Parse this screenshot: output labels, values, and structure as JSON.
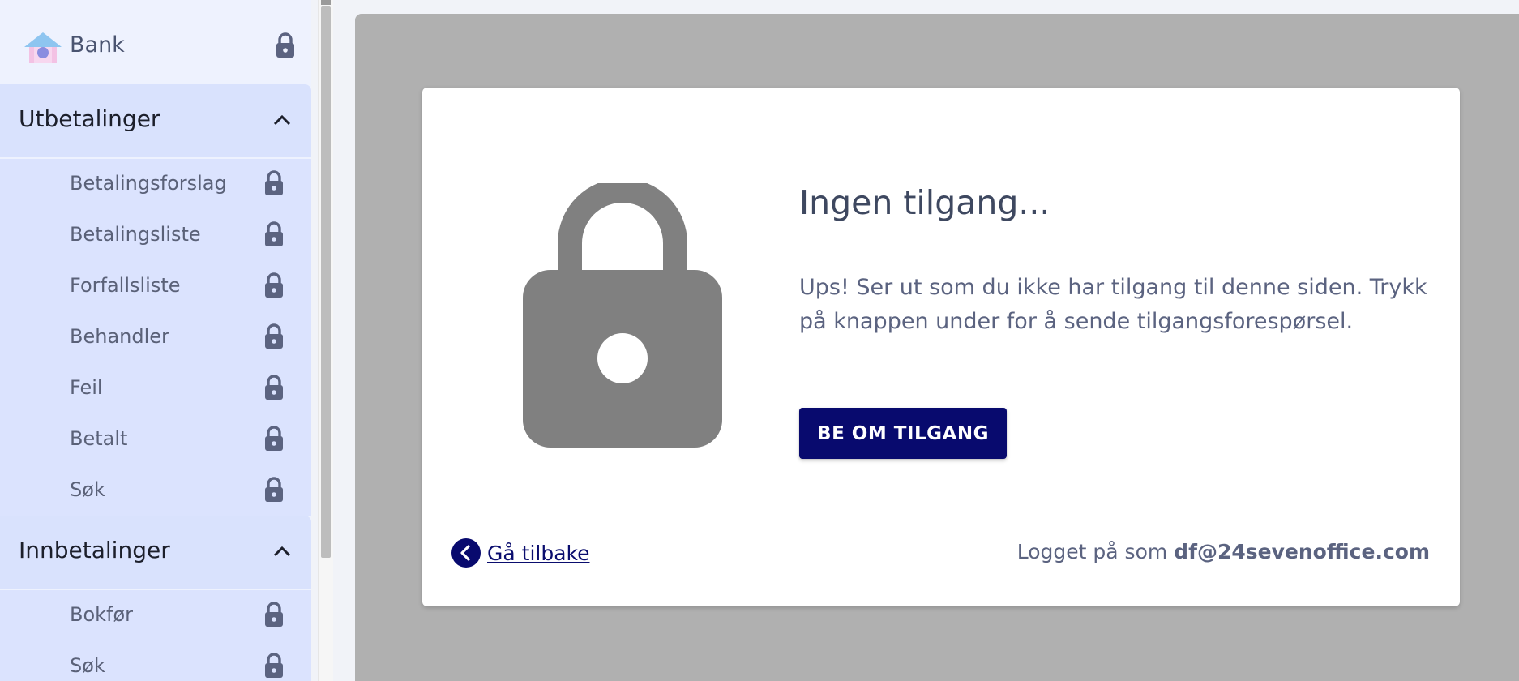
{
  "sidebar": {
    "app_title": "Bank",
    "sections": [
      {
        "label": "Utbetalinger",
        "items": [
          {
            "label": "Betalingsforslag"
          },
          {
            "label": "Betalingsliste"
          },
          {
            "label": "Forfallsliste"
          },
          {
            "label": "Behandler"
          },
          {
            "label": "Feil"
          },
          {
            "label": "Betalt"
          },
          {
            "label": "Søk"
          }
        ]
      },
      {
        "label": "Innbetalinger",
        "items": [
          {
            "label": "Bokfør"
          },
          {
            "label": "Søk"
          }
        ]
      }
    ]
  },
  "dialog": {
    "title": "Ingen tilgang...",
    "message": "Ups! Ser ut som du ikke har tilgang til denne siden. Trykk på knappen under for å sende tilgangsforespørsel.",
    "button_label": "BE OM TILGANG",
    "back_label": "Gå tilbake",
    "login_prefix": "Logget på som",
    "login_email": "df@24sevenoffice.com"
  },
  "colors": {
    "sidebar_bg": "#eef2fe",
    "section_bg": "#d9e2fd",
    "button_bg": "#080a6e",
    "overlay": "#b0b0b0",
    "lock_gray": "#808080"
  },
  "icons": {
    "logo": "bank-logo-icon",
    "lock": "lock-icon",
    "chevron": "chevron-up-icon",
    "back": "chevron-left-circle-icon"
  }
}
